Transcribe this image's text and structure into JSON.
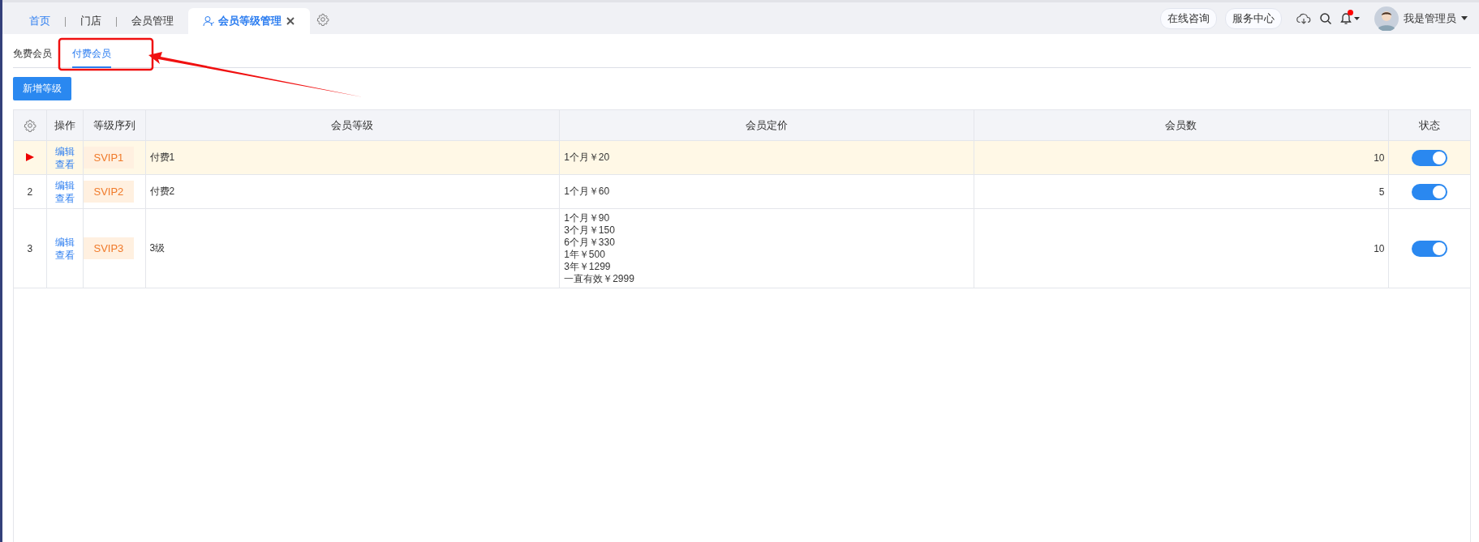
{
  "top_tabs": [
    {
      "label": "首页",
      "kind": "home",
      "selected": false
    },
    {
      "label": "门店",
      "kind": "plain",
      "selected": false
    },
    {
      "label": "会员管理",
      "kind": "plain",
      "selected": false
    },
    {
      "label": "会员等级管理",
      "kind": "closable",
      "selected": true
    }
  ],
  "header_actions": {
    "pills": [
      "在线咨询",
      "服务中心"
    ],
    "notification_dot": true,
    "user_name": "我是管理员"
  },
  "sub_tabs": [
    {
      "label": "免费会员",
      "selected": false
    },
    {
      "label": "付费会员",
      "selected": true
    }
  ],
  "add_button": "新增等级",
  "table": {
    "columns": [
      "操作",
      "等级序列",
      "会员等级",
      "会员定价",
      "会员数",
      "状态"
    ],
    "rows": [
      {
        "selected": true,
        "actions": [
          "编辑",
          "查看"
        ],
        "tag": "SVIP1",
        "level_name": "付费1",
        "prices": [
          "1个月￥20"
        ],
        "member_count": "10",
        "on": true
      },
      {
        "index": "2",
        "selected": false,
        "actions": [
          "编辑",
          "查看"
        ],
        "tag": "SVIP2",
        "level_name": "付费2",
        "prices": [
          "1个月￥60"
        ],
        "member_count": "5",
        "on": true
      },
      {
        "index": "3",
        "selected": false,
        "actions": [
          "编辑",
          "查看"
        ],
        "tag": "SVIP3",
        "level_name": "3级",
        "prices": [
          "1个月￥90",
          "3个月￥150",
          "6个月￥330",
          "1年￥500",
          "3年￥1299",
          "一直有效￥2999"
        ],
        "member_count": "10",
        "on": true
      }
    ]
  },
  "annotation": {
    "highlight_box": true,
    "arrow": true
  }
}
